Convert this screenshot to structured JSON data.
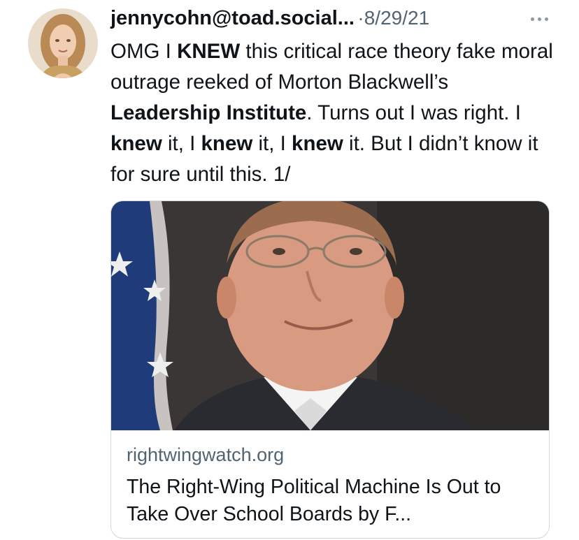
{
  "tweet": {
    "author_handle": "jennycohn@toad.social...",
    "separator": "·",
    "date": "8/29/21",
    "text_segments": [
      {
        "text": "OMG I ",
        "bold": false
      },
      {
        "text": "KNEW",
        "bold": true
      },
      {
        "text": " this critical race theory fake moral outrage reeked of Morton Blackwell’s ",
        "bold": false
      },
      {
        "text": "Leadership Institute",
        "bold": true
      },
      {
        "text": ". Turns out I was right. I ",
        "bold": false
      },
      {
        "text": "knew",
        "bold": true
      },
      {
        "text": " it, I ",
        "bold": false
      },
      {
        "text": "knew",
        "bold": true
      },
      {
        "text": " it, I ",
        "bold": false
      },
      {
        "text": "knew",
        "bold": true
      },
      {
        "text": " it. But I didn’t know it for sure until this. 1/",
        "bold": false
      }
    ]
  },
  "card": {
    "domain": "rightwingwatch.org",
    "title": "The Right-Wing Political Machine Is Out to Take Over School Boards by F..."
  },
  "icons": {
    "more": "more-horizontal-icon"
  },
  "colors": {
    "text": "#0f1419",
    "secondary": "#536471",
    "border": "#cfd9de"
  }
}
